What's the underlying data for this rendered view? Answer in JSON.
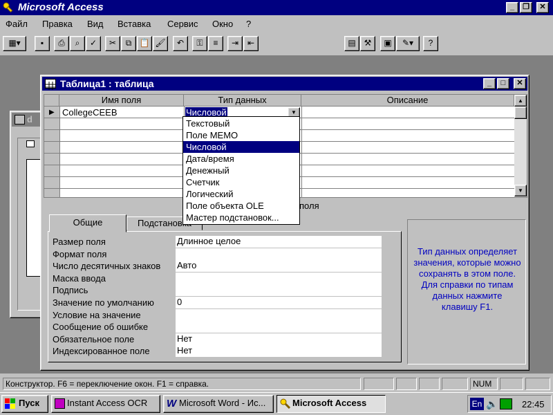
{
  "app": {
    "title": "Microsoft Access"
  },
  "menu": [
    "Файл",
    "Правка",
    "Вид",
    "Вставка",
    "Сервис",
    "Окно",
    "?"
  ],
  "table_window": {
    "title": "Таблица1 : таблица"
  },
  "background_window": {
    "title": "d"
  },
  "grid": {
    "headers": [
      "Имя поля",
      "Тип данных",
      "Описание"
    ],
    "field_name": "CollegeCEEB",
    "data_type": "Числовой"
  },
  "dropdown": {
    "options": [
      "Текстовый",
      "Поле MEMO",
      "Числовой",
      "Дата/время",
      "Денежный",
      "Счетчик",
      "Логический",
      "Поле объекта OLE",
      "Мастер подстановок..."
    ],
    "selected": "Числовой"
  },
  "properties_heading": "поля",
  "tabs": [
    "Общие",
    "Подстановка"
  ],
  "properties": [
    {
      "label": "Размер поля",
      "value": "Длинное целое"
    },
    {
      "label": "Формат поля",
      "value": ""
    },
    {
      "label": "Число десятичных знаков",
      "value": "Авто"
    },
    {
      "label": "Маска ввода",
      "value": ""
    },
    {
      "label": "Подпись",
      "value": ""
    },
    {
      "label": "Значение по умолчанию",
      "value": "0"
    },
    {
      "label": "Условие на значение",
      "value": ""
    },
    {
      "label": "Сообщение об ошибке",
      "value": ""
    },
    {
      "label": "Обязательное поле",
      "value": "Нет"
    },
    {
      "label": "Индексированное поле",
      "value": "Нет"
    }
  ],
  "help_text": "Тип данных определяет значения, которые можно сохранять в этом поле. Для справки по типам данных нажмите клавишу F1.",
  "status": {
    "text": "Конструктор.  F6 = переключение окон.  F1 = справка.",
    "num": "NUM"
  },
  "taskbar": {
    "start": "Пуск",
    "buttons": [
      "Instant Access OCR",
      "Microsoft Word - Ис...",
      "Microsoft Access"
    ],
    "lang": "En",
    "clock": "22:45"
  },
  "colors": {
    "titlebar": "#000080",
    "face": "#c0c0c0",
    "help_text": "#0000c0",
    "selection": "#000080"
  }
}
